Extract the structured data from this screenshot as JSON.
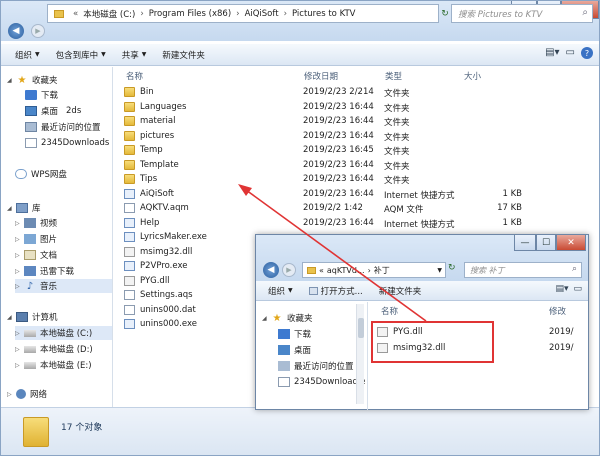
{
  "address": {
    "crumbs": [
      "本地磁盘 (C:)",
      "Program Files (x86)",
      "AiQiSoft",
      "Pictures to KTV"
    ],
    "search_placeholder": "搜索 Pictures to KTV"
  },
  "toolbar": {
    "organize": "组织",
    "include_library": "包含到库中",
    "share": "共享",
    "new_folder": "新建文件夹"
  },
  "nav": {
    "favorites": "收藏夹",
    "download": "下载",
    "desktop": "桌面",
    "recent": "最近访问的位置",
    "downloads2345": "2345Downloads",
    "wps": "WPS网盘",
    "library": "库",
    "video": "视频",
    "pictures": "图片",
    "documents": "文档",
    "xunlei": "迅雷下载",
    "music": "音乐",
    "computer": "计算机",
    "drive_c": "本地磁盘 (C:)",
    "drive_d": "本地磁盘 (D:)",
    "drive_e": "本地磁盘 (E:)",
    "network": "网络",
    "overlay_2ds": "2ds"
  },
  "columns": {
    "name": "名称",
    "modified": "修改日期",
    "type": "类型",
    "size": "大小"
  },
  "files": [
    {
      "name": "Bin",
      "date": "2019/2/23 2/214",
      "type": "文件夹",
      "size": "",
      "icon": "folder"
    },
    {
      "name": "Languages",
      "date": "2019/2/23 16:44",
      "type": "文件夹",
      "size": "",
      "icon": "folder"
    },
    {
      "name": "material",
      "date": "2019/2/23 16:44",
      "type": "文件夹",
      "size": "",
      "icon": "folder"
    },
    {
      "name": "pictures",
      "date": "2019/2/23 16:44",
      "type": "文件夹",
      "size": "",
      "icon": "folder"
    },
    {
      "name": "Temp",
      "date": "2019/2/23 16:45",
      "type": "文件夹",
      "size": "",
      "icon": "folder"
    },
    {
      "name": "Template",
      "date": "2019/2/23 16:44",
      "type": "文件夹",
      "size": "",
      "icon": "folder"
    },
    {
      "name": "Tips",
      "date": "2019/2/23 16:44",
      "type": "文件夹",
      "size": "",
      "icon": "folder"
    },
    {
      "name": "AiQiSoft",
      "date": "2019/2/23 16:44",
      "type": "Internet 快捷方式",
      "size": "1 KB",
      "icon": "url"
    },
    {
      "name": "AQKTV.aqm",
      "date": "2019/2/2 1:42",
      "type": "AQM 文件",
      "size": "17 KB",
      "icon": "file"
    },
    {
      "name": "Help",
      "date": "2019/2/23 16:44",
      "type": "Internet 快捷方式",
      "size": "1 KB",
      "icon": "url"
    },
    {
      "name": "LyricsMaker.exe",
      "date": "",
      "type": "",
      "size": "",
      "icon": "exe"
    },
    {
      "name": "msimg32.dll",
      "date": "",
      "type": "",
      "size": "",
      "icon": "dll"
    },
    {
      "name": "P2VPro.exe",
      "date": "",
      "type": "",
      "size": "",
      "icon": "exe"
    },
    {
      "name": "PYG.dll",
      "date": "",
      "type": "",
      "size": "",
      "icon": "dll"
    },
    {
      "name": "Settings.aqs",
      "date": "",
      "type": "",
      "size": "",
      "icon": "file"
    },
    {
      "name": "unins000.dat",
      "date": "",
      "type": "",
      "size": "",
      "icon": "file"
    },
    {
      "name": "unins000.exe",
      "date": "",
      "type": "",
      "size": "",
      "icon": "exe"
    }
  ],
  "status": {
    "count": "17 个对象"
  },
  "inner": {
    "crumbs": [
      "aqKTVd...",
      "补丁"
    ],
    "search_placeholder": "搜索 补丁",
    "organize": "组织",
    "open_mode": "打开方式...",
    "new_folder": "新建文件夹",
    "col_name": "名称",
    "col_modified": "修改",
    "nav": {
      "favorites": "收藏夹",
      "download": "下载",
      "desktop": "桌面",
      "recent": "最近访问的位置",
      "downloads2345": "2345Downloadle"
    },
    "files": [
      {
        "name": "PYG.dll",
        "date": "2019/"
      },
      {
        "name": "msimg32.dll",
        "date": "2019/"
      }
    ]
  },
  "colors": {
    "annotation_red": "#e03434"
  }
}
